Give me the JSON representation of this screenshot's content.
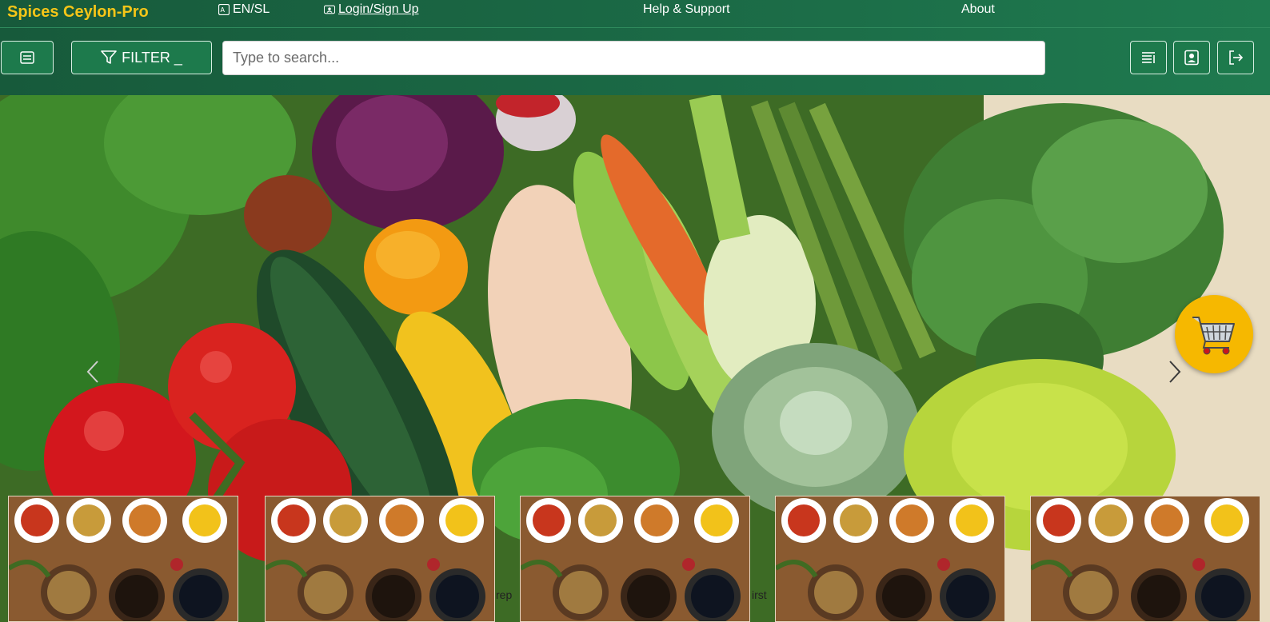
{
  "header": {
    "brand": "Spices Ceylon-Pro",
    "language": "EN/SL",
    "login": "Login/Sign Up",
    "help": "Help & Support",
    "about": "About"
  },
  "toolbar": {
    "filter_label": "FILTER _",
    "search_placeholder": "Type to search...",
    "icons": [
      "sidebar-menu-icon",
      "filter-icon",
      "list-icon",
      "user-profile-icon",
      "logout-icon"
    ]
  },
  "hero": {
    "image": "fresh vegetables",
    "icons": [
      "chevron-left-icon",
      "chevron-right-icon",
      "shopping-cart-icon"
    ]
  },
  "products": [
    {
      "image": "spices"
    },
    {
      "image": "spices"
    },
    {
      "image": "spices"
    },
    {
      "image": "spices"
    },
    {
      "image": "spices"
    }
  ],
  "captions": [
    "rep",
    "irst"
  ],
  "colors": {
    "header_green": "#1b6a46",
    "brand_yellow": "#f5c518",
    "button_green": "#1d7a4c",
    "cart_yellow": "#f6b800"
  }
}
